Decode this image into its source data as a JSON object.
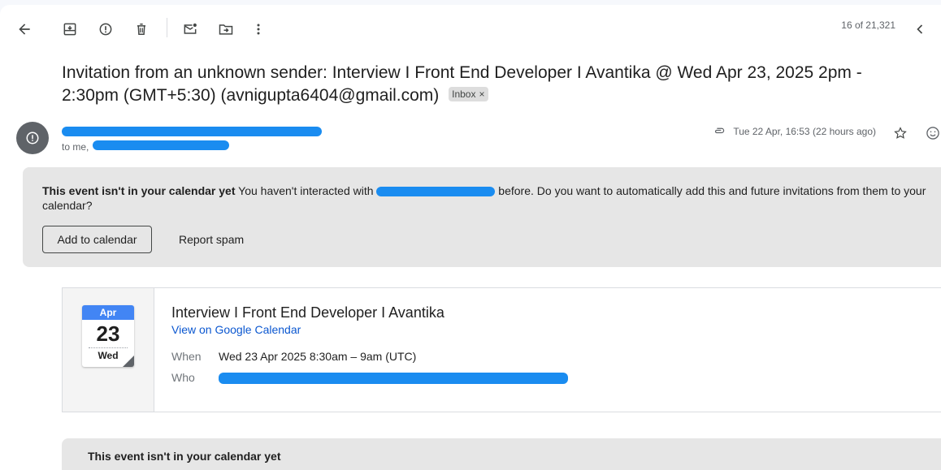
{
  "toolbar": {
    "counter": "16 of 21,321"
  },
  "email": {
    "subject": "Invitation from an unknown sender: Interview I Front End Developer I Avantika @ Wed Apr 23, 2025 2pm - 2:30pm (GMT+5:30) (avnigupta6404@gmail.com)",
    "label": "Inbox",
    "label_close": "×",
    "to_prefix": "to me,",
    "timestamp": "Tue 22 Apr, 16:53 (22 hours ago)"
  },
  "calendar_warning": {
    "heading": "This event isn't in your calendar yet",
    "message_before": " You haven't interacted with ",
    "message_after": " before. Do you want to automatically add this and future invitations from them to your calendar?",
    "add_button": "Add to calendar",
    "spam_button": "Report spam"
  },
  "event": {
    "month": "Apr",
    "day": "23",
    "weekday": "Wed",
    "title": "Interview I Front End Developer I Avantika",
    "calendar_link": "View on Google Calendar",
    "when_label": "When",
    "when_value": "Wed 23 Apr 2025 8:30am – 9am (UTC)",
    "who_label": "Who"
  },
  "second_warning": {
    "heading": "This event isn't in your calendar yet"
  },
  "colors": {
    "accent_blue": "#0b57d0",
    "calendar_blue": "#4285f4",
    "redaction": "#1a8cf0"
  }
}
